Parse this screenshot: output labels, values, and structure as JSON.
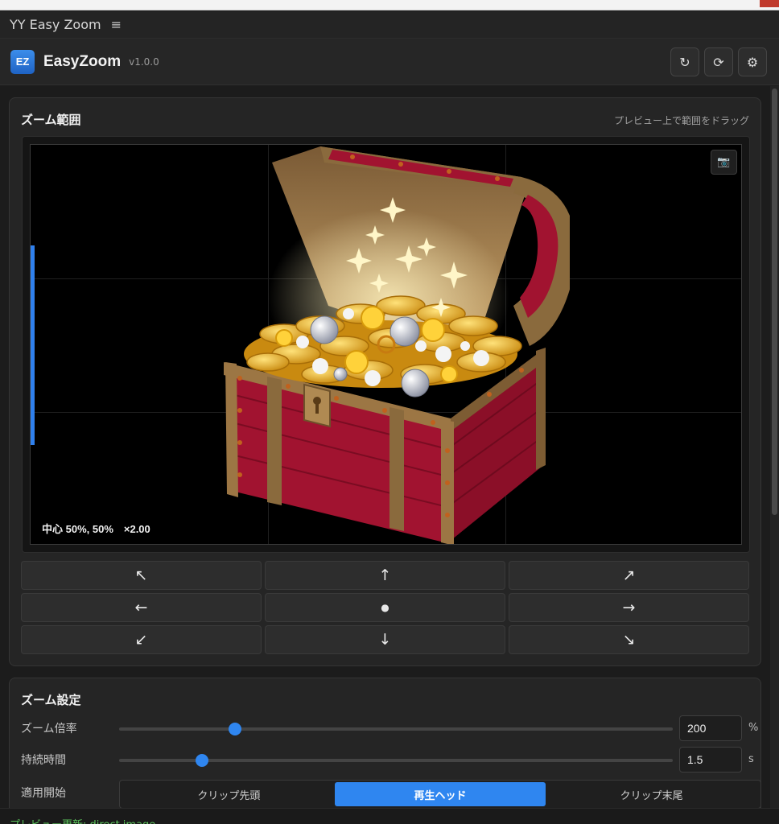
{
  "window": {
    "title": "YY Easy Zoom",
    "menu_icon": "≡"
  },
  "app": {
    "logo_text": "EZ",
    "name": "EasyZoom",
    "version": "v1.0.0",
    "header_buttons": [
      {
        "name": "undo-button",
        "icon": "↻"
      },
      {
        "name": "refresh-button",
        "icon": "⟳"
      },
      {
        "name": "settings-button",
        "icon": "⚙"
      }
    ]
  },
  "zoom_range": {
    "title": "ズーム範囲",
    "hint": "プレビュー上で範囲をドラッグ",
    "status": "中心 50%, 50%　×2.00",
    "camera_icon": "📷"
  },
  "directions": [
    {
      "name": "pan-up-left-button",
      "label": "↖"
    },
    {
      "name": "pan-up-button",
      "label": "↑"
    },
    {
      "name": "pan-up-right-button",
      "label": "↗"
    },
    {
      "name": "pan-left-button",
      "label": "←"
    },
    {
      "name": "pan-center-button",
      "label": "●"
    },
    {
      "name": "pan-right-button",
      "label": "→"
    },
    {
      "name": "pan-down-left-button",
      "label": "↙"
    },
    {
      "name": "pan-down-button",
      "label": "↓"
    },
    {
      "name": "pan-down-right-button",
      "label": "↘"
    }
  ],
  "zoom_settings": {
    "title": "ズーム設定",
    "magnification": {
      "label": "ズーム倍率",
      "value": "200",
      "unit": "%",
      "slider_fraction": 0.21
    },
    "duration": {
      "label": "持続時間",
      "value": "1.5",
      "unit": "s",
      "slider_fraction": 0.15
    },
    "apply_start": {
      "label": "適用開始",
      "options": [
        "クリップ先頭",
        "再生ヘッド",
        "クリップ末尾"
      ],
      "selected": "再生ヘッド"
    }
  },
  "footer": {
    "status": "プレビュー更新: direct image"
  },
  "colors": {
    "accent": "#2f86f0",
    "status_green": "#5cc45c"
  }
}
